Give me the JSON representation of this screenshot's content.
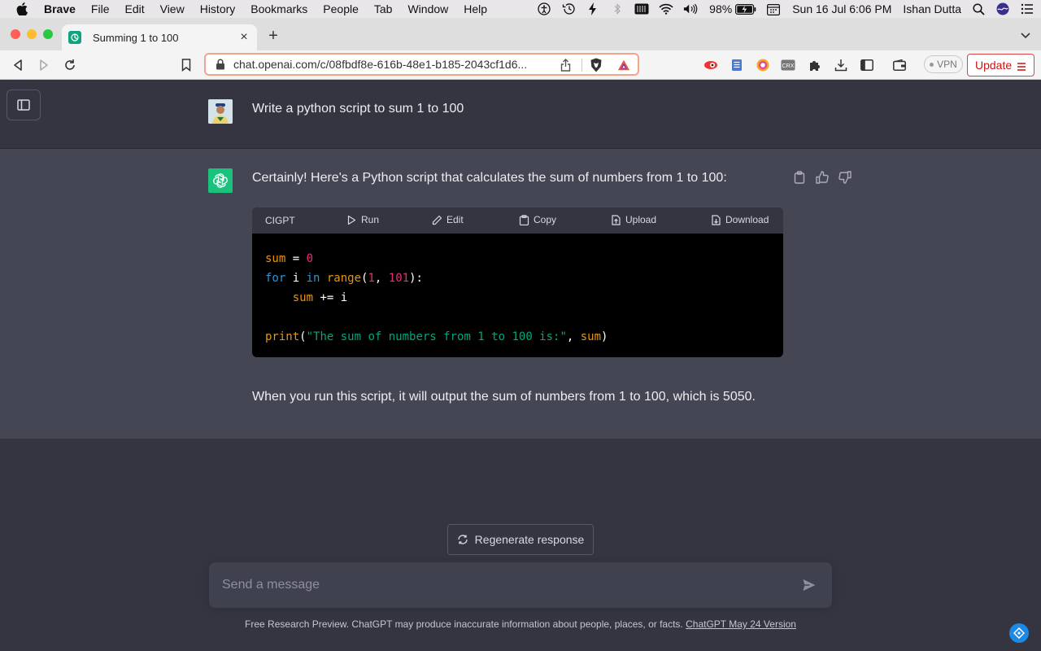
{
  "menubar": {
    "app": "Brave",
    "items": [
      "File",
      "Edit",
      "View",
      "History",
      "Bookmarks",
      "People",
      "Tab",
      "Window",
      "Help"
    ],
    "battery": "98%",
    "datetime": "Sun 16 Jul  6:06 PM",
    "user": "Ishan Dutta"
  },
  "browser": {
    "tab_title": "Summing 1 to 100",
    "url": "chat.openai.com/c/08fbdf8e-616b-48e1-b185-2043cf1d6...",
    "vpn_label": "VPN",
    "update_label": "Update"
  },
  "conversation": {
    "user_message": "Write a python script to sum 1 to 100",
    "assistant_intro": "Certainly! Here's a Python script that calculates the sum of numbers from 1 to 100:",
    "assistant_outro": "When you run this script, it will output the sum of numbers from 1 to 100, which is 5050.",
    "code_toolbar": {
      "label": "CIGPT",
      "run": "Run",
      "edit": "Edit",
      "copy": "Copy",
      "upload": "Upload",
      "download": "Download"
    },
    "code": {
      "l1_var": "sum",
      "l1_op": " = ",
      "l1_num": "0",
      "l2_kw1": "for",
      "l2_i": " i ",
      "l2_kw2": "in",
      "l2_fn": " range",
      "l2_p1": "(",
      "l2_n1": "1",
      "l2_c": ", ",
      "l2_n2": "101",
      "l2_p2": "):",
      "l3_indent": "    ",
      "l3_var": "sum",
      "l3_rest": " += i",
      "l5_fn": "print",
      "l5_p1": "(",
      "l5_str": "\"The sum of numbers from 1 to 100 is:\"",
      "l5_c": ", ",
      "l5_var": "sum",
      "l5_p2": ")"
    }
  },
  "actions": {
    "regenerate": "Regenerate response"
  },
  "composer": {
    "placeholder": "Send a message"
  },
  "footer": {
    "text": "Free Research Preview. ChatGPT may produce inaccurate information about people, places, or facts. ",
    "link": "ChatGPT May 24 Version"
  },
  "colors": {
    "page_bg": "#343541",
    "assistant_bg": "#444654",
    "gpt_green": "#19c37d",
    "url_border": "#f2a48c"
  }
}
